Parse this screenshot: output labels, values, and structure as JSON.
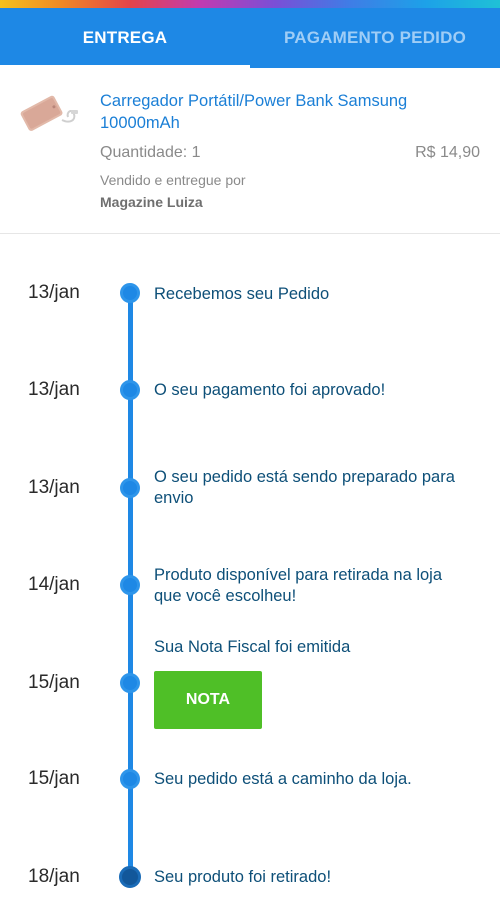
{
  "tabs": [
    {
      "label": "ENTREGA",
      "active": true
    },
    {
      "label": "PAGAMENTO PEDIDO",
      "active": false
    }
  ],
  "product": {
    "title": "Carregador Portátil/Power Bank Samsung 10000mAh",
    "quantity": "Quantidade: 1",
    "price": "R$ 14,90",
    "sold_by_label": "Vendido e entregue por",
    "seller": "Magazine Luiza",
    "image_icon": "power-bank-image"
  },
  "timeline": [
    {
      "date": "13/jan",
      "text": "Recebemos seu Pedido"
    },
    {
      "date": "13/jan",
      "text": "O seu pagamento foi aprovado!"
    },
    {
      "date": "13/jan",
      "text": "O seu pedido está sendo preparado para envio"
    },
    {
      "date": "14/jan",
      "text": "Produto disponível para retirada na loja que você escolheu!"
    },
    {
      "date": "15/jan",
      "text": "Sua Nota Fiscal foi emitida",
      "button": "NOTA"
    },
    {
      "date": "15/jan",
      "text": "Seu pedido está a caminho da loja."
    },
    {
      "date": "18/jan",
      "text": "Seu produto foi retirado!"
    }
  ],
  "colors": {
    "primary": "#1e88e5",
    "link_text": "#1b7fd6",
    "timeline_text": "#0d4f78",
    "button_green": "#4fbf27"
  }
}
